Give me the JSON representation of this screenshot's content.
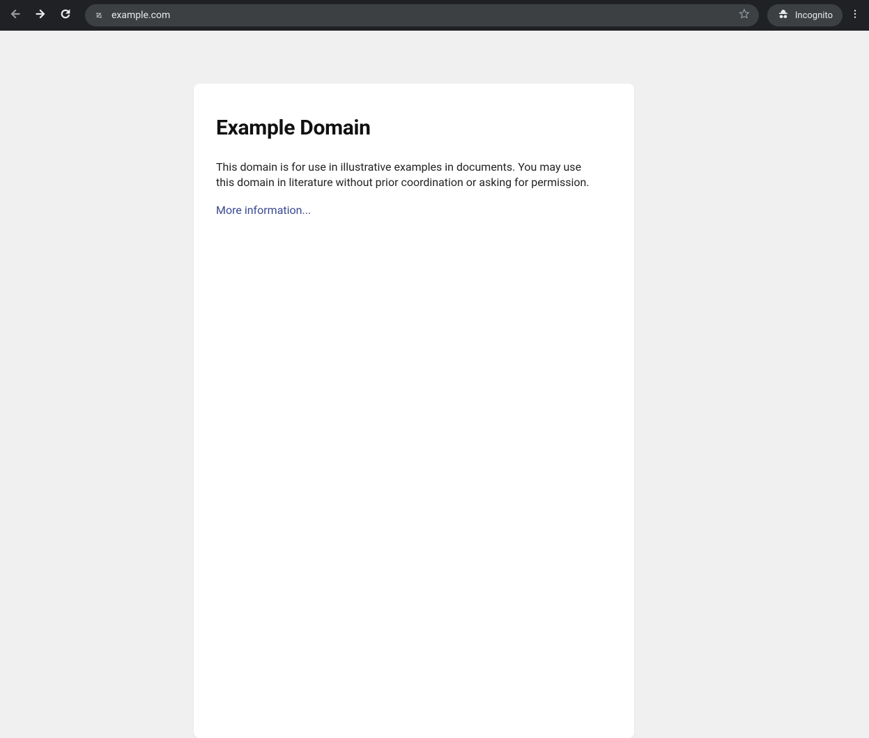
{
  "browser": {
    "url": "example.com",
    "incognito_label": "Incognito"
  },
  "page": {
    "title": "Example Domain",
    "paragraph": "This domain is for use in illustrative examples in documents. You may use this domain in literature without prior coordination or asking for permission.",
    "link_text": "More information..."
  }
}
